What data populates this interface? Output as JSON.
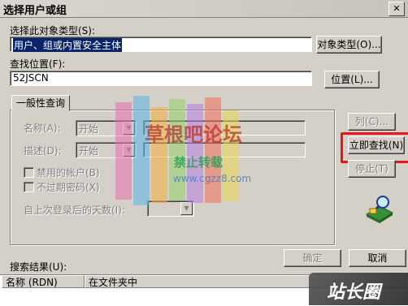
{
  "window": {
    "title": "选择用户或组"
  },
  "object_type": {
    "label": "选择此对象类型(S):",
    "value": "用户、组或内置安全主体",
    "button": "对象类型(O)..."
  },
  "location": {
    "label": "查找位置(F):",
    "value": "52JSCN",
    "button": "位置(L)..."
  },
  "query": {
    "tab": "一般性查询",
    "name_label": "名称(A):",
    "name_mode": "开始",
    "desc_label": "描述(D):",
    "desc_mode": "开始",
    "disabled_accounts": "禁用的帐户(B)",
    "non_expiring_pw": "不过期密码(X)",
    "days_label": "自上次登录后的天数(I):"
  },
  "side_buttons": {
    "columns": "列(C)...",
    "find_now": "立即查找(N)",
    "stop": "停止(T)"
  },
  "dialog_buttons": {
    "ok": "确定",
    "cancel": "取消"
  },
  "results": {
    "label": "搜索结果(U):",
    "columns": [
      "名称 (RDN)",
      "在文件夹中"
    ]
  },
  "watermark": {
    "line1": "草根吧论坛",
    "line2": "禁止转载",
    "line3": "www.cgzz8.com",
    "corner": "站长圈"
  },
  "colors": {
    "highlight": "#e8161a",
    "selection": "#0a246a",
    "face": "#d4d0c8"
  }
}
